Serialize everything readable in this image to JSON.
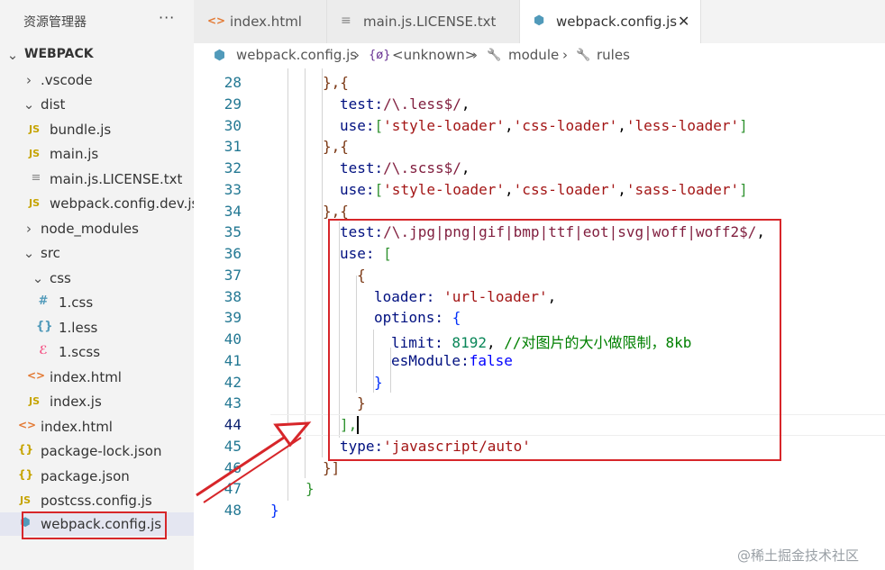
{
  "sidebar": {
    "header": "资源管理器",
    "more": "···",
    "root": "WEBPACK",
    "items": [
      {
        "label": ".vscode",
        "icon": "›",
        "kind": "folder-collapsed"
      },
      {
        "label": "dist",
        "icon": "⌄",
        "kind": "folder-expanded"
      },
      {
        "label": "bundle.js",
        "icon": "JS",
        "kind": "js-file"
      },
      {
        "label": "main.js",
        "icon": "JS",
        "kind": "js-file"
      },
      {
        "label": "main.js.LICENSE.txt",
        "icon": "≡",
        "kind": "txt-file"
      },
      {
        "label": "webpack.config.dev.js",
        "icon": "JS",
        "kind": "js-file"
      },
      {
        "label": "node_modules",
        "icon": "›",
        "kind": "folder-collapsed"
      },
      {
        "label": "src",
        "icon": "⌄",
        "kind": "folder-expanded"
      },
      {
        "label": "css",
        "icon": "⌄",
        "kind": "folder-expanded"
      },
      {
        "label": "1.css",
        "icon": "#",
        "kind": "css-file"
      },
      {
        "label": "1.less",
        "icon": "{}",
        "kind": "less-file"
      },
      {
        "label": "1.scss",
        "icon": "ℰ",
        "kind": "scss-file"
      },
      {
        "label": "index.html",
        "icon": "<>",
        "kind": "html-file"
      },
      {
        "label": "index.js",
        "icon": "JS",
        "kind": "js-file"
      },
      {
        "label": "index.html",
        "icon": "<>",
        "kind": "html-file"
      },
      {
        "label": "package-lock.json",
        "icon": "{}",
        "kind": "json-file"
      },
      {
        "label": "package.json",
        "icon": "{}",
        "kind": "json-file"
      },
      {
        "label": "postcss.config.js",
        "icon": "JS",
        "kind": "js-file"
      },
      {
        "label": "webpack.config.js",
        "icon": "⬢",
        "kind": "webpack-file"
      }
    ]
  },
  "tabs": [
    {
      "label": "index.html",
      "icon": "<>"
    },
    {
      "label": "main.js.LICENSE.txt",
      "icon": "≡"
    },
    {
      "label": "webpack.config.js",
      "icon": "⬢",
      "close": "✕"
    }
  ],
  "breadcrumb": {
    "file": "webpack.config.js",
    "sep": "›",
    "unknown": "<unknown>",
    "module": "module",
    "rules": "rules",
    "unknown_icon": "{ø}",
    "wrench_icon": "🔧"
  },
  "editor": {
    "line_numbers": [
      "28",
      "29",
      "30",
      "31",
      "32",
      "33",
      "34",
      "35",
      "36",
      "37",
      "38",
      "39",
      "40",
      "41",
      "42",
      "43",
      "44",
      "45",
      "46",
      "47",
      "48"
    ],
    "lines": {
      "l28": {
        "a": "},{"
      },
      "l29": {
        "a": "test:",
        "b": "/\\.less$/",
        "c": ","
      },
      "l30": {
        "a": "use:",
        "b": "[",
        "c": "'style-loader'",
        "d": ",",
        "e": "'css-loader'",
        "f": ",",
        "g": "'less-loader'",
        "h": "]"
      },
      "l31": {
        "a": "},{"
      },
      "l32": {
        "a": "test:",
        "b": "/\\.scss$/",
        "c": ","
      },
      "l33": {
        "a": "use:",
        "b": "[",
        "c": "'style-loader'",
        "d": ",",
        "e": "'css-loader'",
        "f": ",",
        "g": "'sass-loader'",
        "h": "]"
      },
      "l34": {
        "a": "},{"
      },
      "l35": {
        "a": "test:",
        "b": "/\\.jpg|png|gif|bmp|ttf|eot|svg|woff|woff2$/",
        "c": ","
      },
      "l36": {
        "a": "use:",
        "b": " ["
      },
      "l37": {
        "a": "{"
      },
      "l38": {
        "a": "loader:",
        "b": " 'url-loader'",
        "c": ","
      },
      "l39": {
        "a": "options:",
        "b": " {"
      },
      "l40": {
        "a": "limit:",
        "b": " 8192",
        "c": ",",
        "d": " //对图片的大小做限制，8kb"
      },
      "l41": {
        "a": "esModule:",
        "b": "false"
      },
      "l42": {
        "a": "}"
      },
      "l43": {
        "a": "}"
      },
      "l44": {
        "a": "],"
      },
      "l45": {
        "a": "type:",
        "b": "'javascript/auto'"
      },
      "l46": {
        "a": "}]"
      },
      "l47": {
        "a": "}"
      },
      "l48": {
        "a": "}"
      }
    }
  },
  "watermark": "@稀土掘金技术社区"
}
